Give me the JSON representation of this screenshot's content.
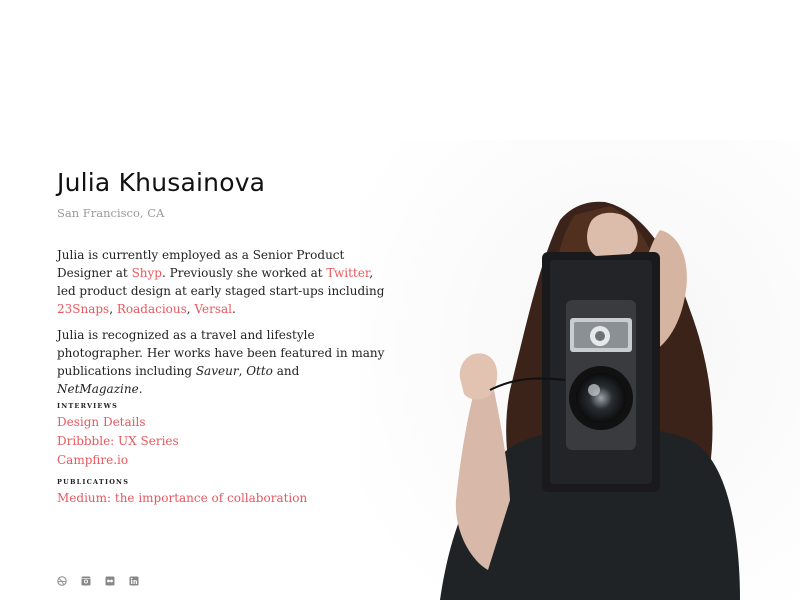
{
  "profile": {
    "name": "Julia Khusainova",
    "location": "San Francisco, CA"
  },
  "bio1": {
    "t1": "Julia is currently employed as a Senior Product Designer at ",
    "link_shyp": "Shyp",
    "t2": ". Previously she worked at ",
    "link_twitter": "Twitter",
    "t3": ", led product design at early staged start-ups including ",
    "link_23snaps": "23Snaps",
    "sep1": ", ",
    "link_roadacious": "Roadacious",
    "sep2": ", ",
    "link_versal": "Versal",
    "end": "."
  },
  "bio2": {
    "t1": "Julia is recognized as a travel and lifestyle photographer. Her works have been featured in many publications including ",
    "pub1": "Saveur",
    "sep1": ", ",
    "pub2": "Otto",
    "t2": " and ",
    "pub3": "NetMagazine",
    "end": "."
  },
  "interviews": {
    "title": "Interviews",
    "links": [
      "Design Details",
      "Dribbble: UX Series",
      "Campfire.io"
    ]
  },
  "publications": {
    "title": "Publications",
    "links": [
      "Medium: the importance of collaboration"
    ]
  },
  "social": {
    "icons": [
      "dribbble-icon",
      "instagram-icon",
      "flickr-icon",
      "linkedin-icon"
    ]
  },
  "colors": {
    "accent": "#e8585e",
    "muted": "#999999",
    "text": "#222222"
  }
}
